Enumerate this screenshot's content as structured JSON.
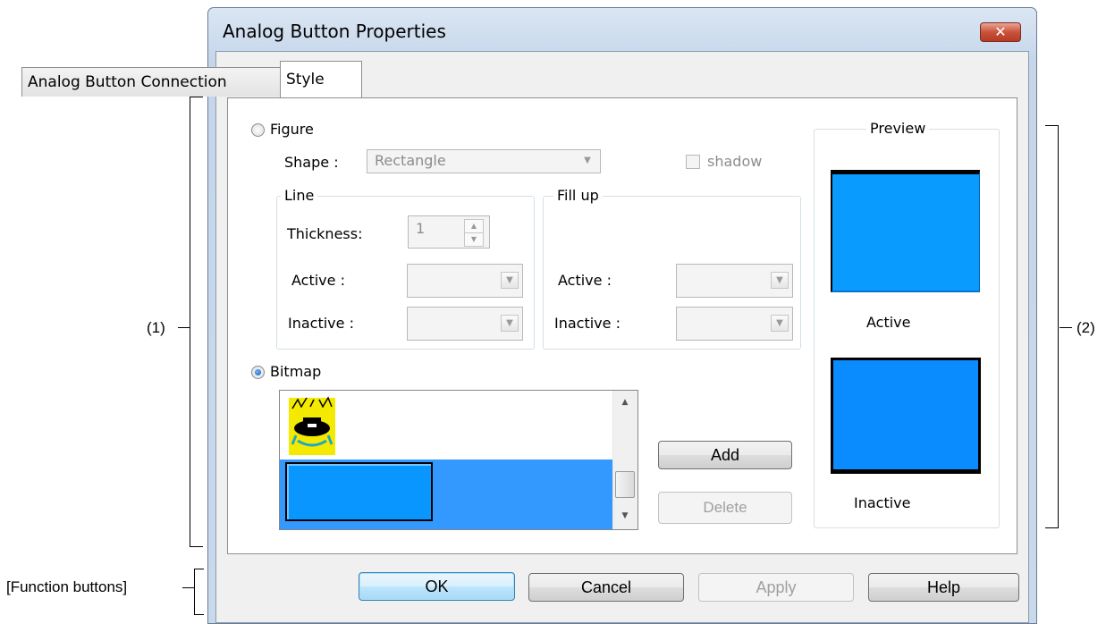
{
  "annotations": {
    "one": "(1)",
    "two": "(2)",
    "function_buttons": "[Function buttons]"
  },
  "window": {
    "title": "Analog Button Properties",
    "close_glyph": "✕"
  },
  "tabs": [
    {
      "label": "Analog Button Connection",
      "selected": false
    },
    {
      "label": "Style",
      "selected": true
    }
  ],
  "figure": {
    "label": "Figure",
    "selected": false,
    "shape_label": "Shape :",
    "shape_value": "Rectangle",
    "shadow_label": "shadow",
    "line": {
      "title": "Line",
      "thickness_label": "Thickness:",
      "thickness_value": "1",
      "active_label": "Active :",
      "inactive_label": "Inactive :"
    },
    "fill": {
      "title": "Fill up",
      "active_label": "Active :",
      "inactive_label": "Inactive :"
    }
  },
  "bitmap": {
    "label": "Bitmap",
    "selected": true,
    "add_label": "Add",
    "delete_label": "Delete"
  },
  "preview": {
    "title": "Preview",
    "active_label": "Active",
    "inactive_label": "Inactive",
    "active_color": "#0a9bff",
    "inactive_color": "#0a8cff"
  },
  "function_buttons": {
    "ok": "OK",
    "cancel": "Cancel",
    "apply": "Apply",
    "help": "Help"
  },
  "colors": {
    "selection": "#3399ff",
    "swatch_blue": "#0a96ff"
  }
}
